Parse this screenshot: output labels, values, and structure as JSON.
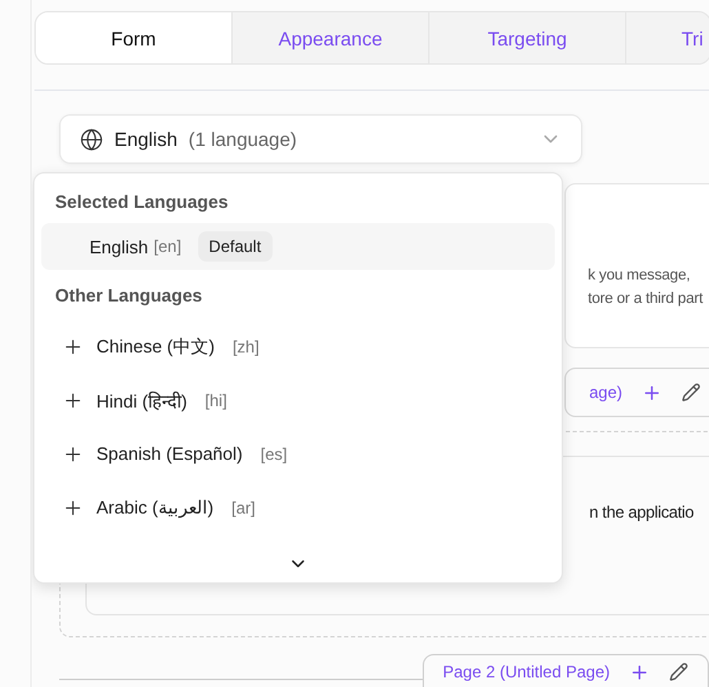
{
  "tabs": [
    {
      "label": "Form",
      "selected": true
    },
    {
      "label": "Appearance",
      "selected": false
    },
    {
      "label": "Targeting",
      "selected": false
    },
    {
      "label": "Tri",
      "selected": false
    }
  ],
  "language_select": {
    "value": "English",
    "count": "(1 language)"
  },
  "dropdown": {
    "selected_heading": "Selected Languages",
    "selected_languages": [
      {
        "name": "English",
        "code": "[en]",
        "badge": "Default"
      }
    ],
    "other_heading": "Other Languages",
    "other_languages": [
      {
        "name": "Chinese (中文)",
        "code": "[zh]"
      },
      {
        "name": "Hindi (हिन्दी)",
        "code": "[hi]"
      },
      {
        "name": "Spanish (Español)",
        "code": "[es]"
      },
      {
        "name": "Arabic (العربية)",
        "code": "[ar]"
      }
    ]
  },
  "background": {
    "card_lines": [
      "k you message,",
      "tore or a third part"
    ],
    "page_link": "age)",
    "question_fragment": "n the applicatio",
    "next_page": "Page 2 (Untitled Page)"
  }
}
